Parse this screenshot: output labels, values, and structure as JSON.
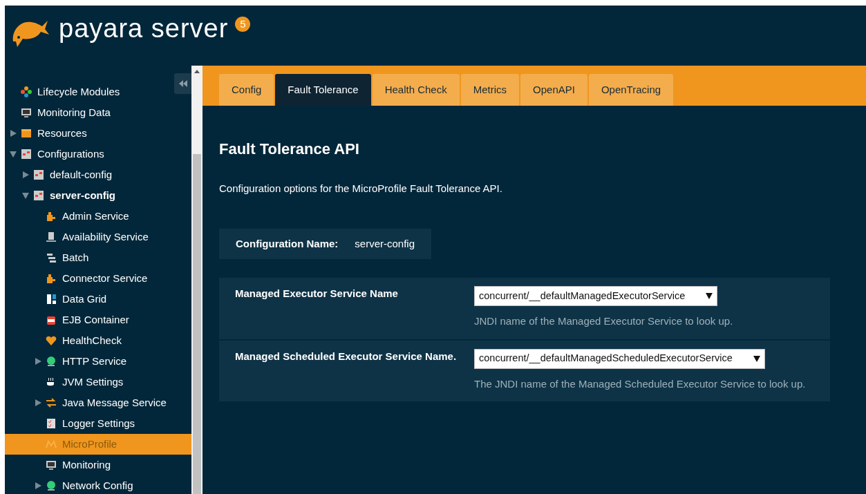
{
  "header": {
    "product": "payara server",
    "version": "5"
  },
  "sidebar": {
    "items": [
      {
        "label": "Lifecycle Modules",
        "selected": false
      },
      {
        "label": "Monitoring Data",
        "selected": false
      },
      {
        "label": "Resources",
        "expanded": false,
        "selected": false
      },
      {
        "label": "Configurations",
        "expanded": true,
        "selected": false,
        "children": [
          {
            "label": "default-config",
            "expanded": false,
            "selected": false
          },
          {
            "label": "server-config",
            "expanded": true,
            "selected": false,
            "children": [
              {
                "label": "Admin Service",
                "selected": false
              },
              {
                "label": "Availability Service",
                "selected": false
              },
              {
                "label": "Batch",
                "selected": false
              },
              {
                "label": "Connector Service",
                "selected": false
              },
              {
                "label": "Data Grid",
                "selected": false
              },
              {
                "label": "EJB Container",
                "selected": false
              },
              {
                "label": "HealthCheck",
                "selected": false
              },
              {
                "label": "HTTP Service",
                "expanded": false,
                "selected": false
              },
              {
                "label": "JVM Settings",
                "selected": false
              },
              {
                "label": "Java Message Service",
                "expanded": false,
                "selected": false
              },
              {
                "label": "Logger Settings",
                "selected": false
              },
              {
                "label": "MicroProfile",
                "selected": true
              },
              {
                "label": "Monitoring",
                "selected": false
              },
              {
                "label": "Network Config",
                "expanded": false,
                "selected": false
              }
            ]
          }
        ]
      }
    ]
  },
  "tabs": [
    {
      "label": "Config",
      "selected": false
    },
    {
      "label": "Fault Tolerance",
      "selected": true
    },
    {
      "label": "Health Check",
      "selected": false
    },
    {
      "label": "Metrics",
      "selected": false
    },
    {
      "label": "OpenAPI",
      "selected": false
    },
    {
      "label": "OpenTracing",
      "selected": false
    }
  ],
  "page": {
    "title": "Fault Tolerance API",
    "description": "Configuration options for the MicroProfile Fault Tolerance API.",
    "config_name": {
      "label": "Configuration Name:",
      "value": "server-config"
    },
    "fields": [
      {
        "label": "Managed Executor Service Name",
        "value": "concurrent/__defaultManagedExecutorService",
        "help": "JNDI name of the Managed Executor Service to look up."
      },
      {
        "label": "Managed Scheduled Executor Service Name.",
        "value": "concurrent/__defaultManagedScheduledExecutorService",
        "help": "The JNDI name of the Managed Scheduled Executor Service to look up."
      }
    ]
  }
}
